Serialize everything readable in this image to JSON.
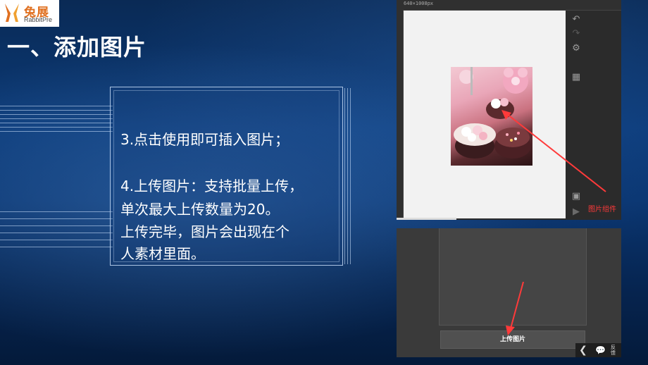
{
  "logo": {
    "cn": "兔展",
    "en": "RabbitPre"
  },
  "slide": {
    "title": "一、添加图片"
  },
  "steps": {
    "step3": "3.点击使用即可插入图片；",
    "step4_line1": "4.上传图片：支持批量上传，",
    "step4_line2": "单次最大上传数量为20。",
    "step4_line3": "上传完毕，图片会出现在个",
    "step4_line4": "人素材里面。"
  },
  "editor": {
    "canvas_size": "640×1008px",
    "component_label": "图片组件",
    "icons": [
      "undo-icon",
      "redo-icon",
      "gear-icon",
      "layer-icon",
      "save-icon",
      "play-icon"
    ]
  },
  "upload_panel": {
    "upload_button": "上传图片",
    "nav_text": "反馈"
  },
  "colors": {
    "annotation_arrow": "#ff3a3a",
    "title_text": "#ffffff"
  }
}
